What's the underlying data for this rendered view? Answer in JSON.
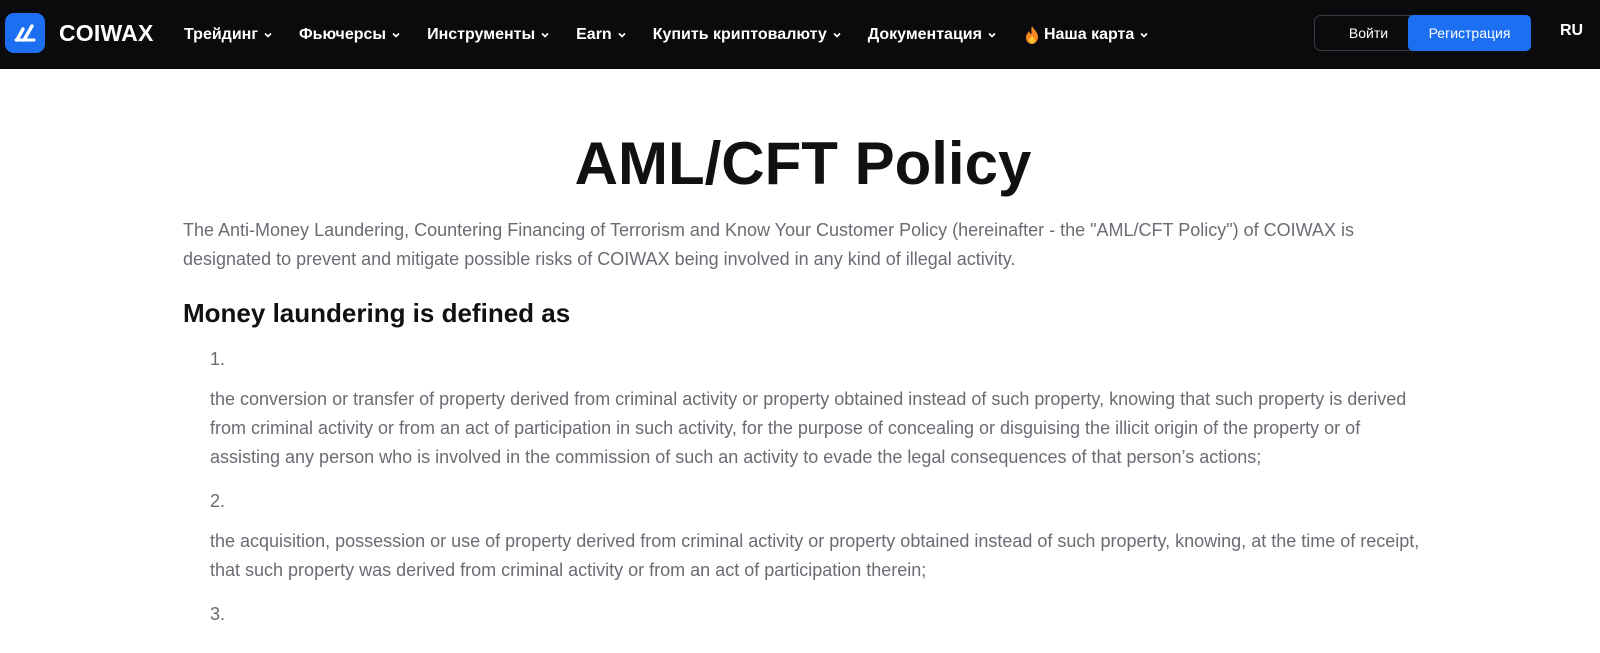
{
  "header": {
    "brand": "COIWAX",
    "nav": [
      {
        "label": "Трейдинг"
      },
      {
        "label": "Фьючерсы"
      },
      {
        "label": "Инструменты"
      },
      {
        "label": "Earn"
      },
      {
        "label": "Купить криптовалюту"
      },
      {
        "label": "Документация"
      },
      {
        "label": "Наша карта",
        "icon": "fire-icon"
      }
    ],
    "login_label": "Войти",
    "register_label": "Регистрация",
    "language": "RU"
  },
  "colors": {
    "accent": "#1d6ff2",
    "topbar": "#0b0b0e",
    "body_text": "#6b6b73",
    "heading": "#111114"
  },
  "main": {
    "title": "AML/CFT Policy",
    "intro": "The Anti-Money Laundering, Countering Financing of Terrorism and Know Your Customer Policy (hereinafter - the \"AML/CFT Policy\") of COIWAX is designated to prevent and mitigate possible risks of COIWAX being involved in any kind of illegal activity.",
    "section_heading": "Money laundering is defined as",
    "items": [
      {
        "number": "1.",
        "text": "the conversion or transfer of property derived from criminal activity or property obtained instead of such property, knowing that such property is derived from criminal activity or from an act of participation in such activity, for the purpose of concealing or disguising the illicit origin of the property or of assisting any person who is involved in the commission of such an activity to evade the legal consequences of that person’s actions;"
      },
      {
        "number": "2.",
        "text": "the acquisition, possession or use of property derived from criminal activity or property obtained instead of such property, knowing, at the time of receipt, that such property was derived from criminal activity or from an act of participation therein;"
      },
      {
        "number": "3."
      }
    ]
  }
}
